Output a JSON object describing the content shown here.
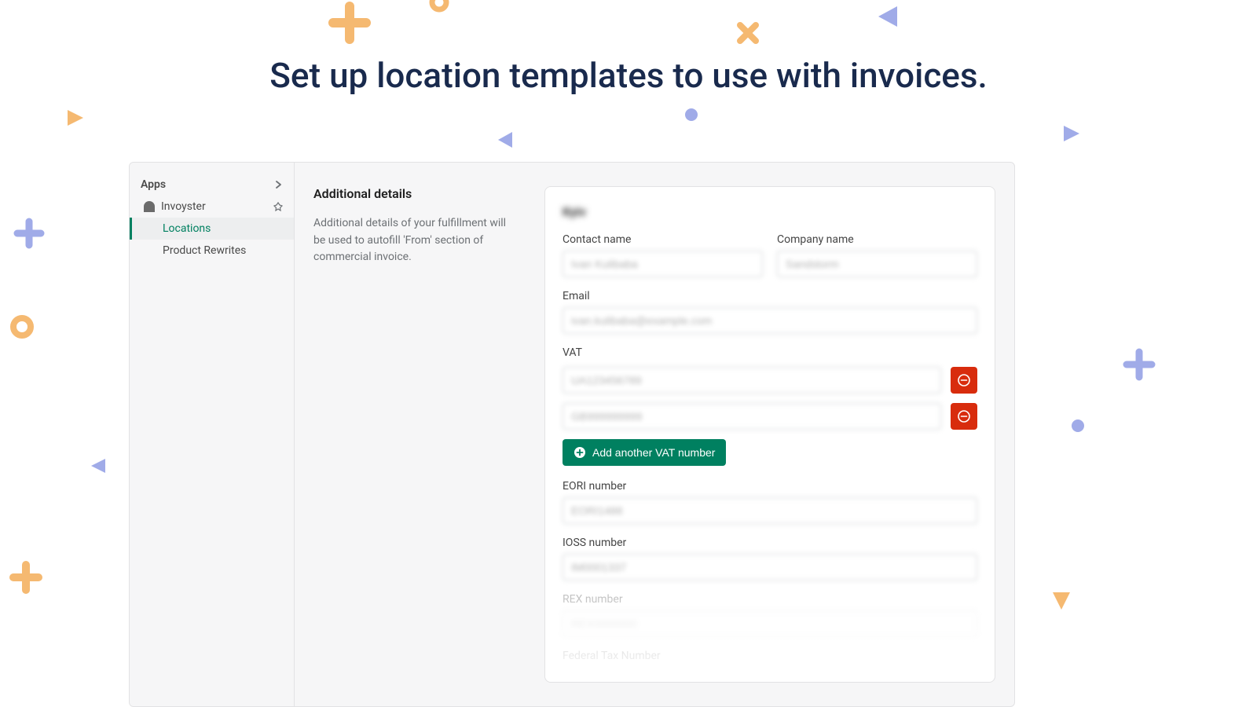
{
  "headline": "Set up location templates to use with invoices.",
  "sidebar": {
    "apps_label": "Apps",
    "app_name": "Invoyster",
    "items": [
      {
        "label": "Locations"
      },
      {
        "label": "Product Rewrites"
      }
    ]
  },
  "description": {
    "title": "Additional details",
    "text": "Additional details of your fulfillment will be used to autofill 'From' section of commercial invoice."
  },
  "form": {
    "card_title": "Kyiv",
    "contact_name_label": "Contact name",
    "contact_name_value": "Ivan Kulibaba",
    "company_name_label": "Company name",
    "company_name_value": "Sandstorm",
    "email_label": "Email",
    "email_value": "ivan.kulibaba@example.com",
    "vat_label": "VAT",
    "vat_values": [
      "UA123456789",
      "GB999999999"
    ],
    "add_vat_label": "Add another VAT number",
    "eori_label": "EORI number",
    "eori_value": "EORI1488",
    "ioss_label": "IOSS number",
    "ioss_value": "IM0001337",
    "rex_label": "REX number",
    "rex_value": "REX0000000",
    "federal_label": "Federal Tax Number"
  },
  "colors": {
    "accent": "#008060",
    "danger": "#d82c0d",
    "headline": "#192a4d",
    "deco_orange": "#f5b971",
    "deco_blue": "#a0abe8"
  }
}
